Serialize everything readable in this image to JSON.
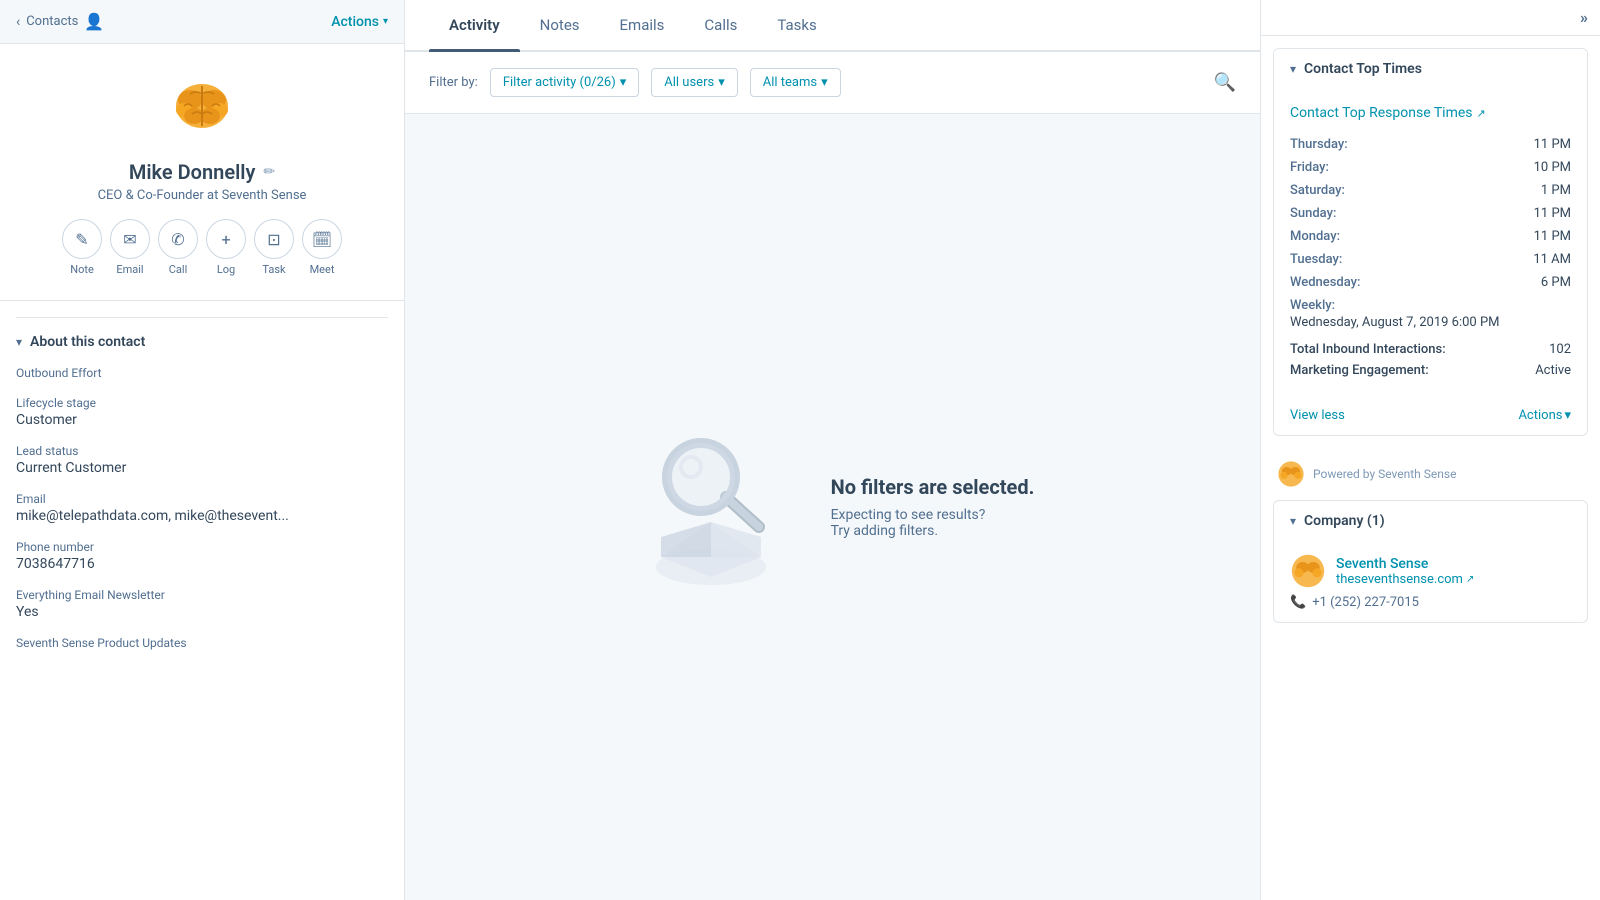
{
  "sidebar": {
    "back_label": "Contacts",
    "actions_label": "Actions",
    "contact": {
      "name": "Mike Donnelly",
      "title": "CEO & Co-Founder at Seventh Sense"
    },
    "action_buttons": [
      {
        "id": "note",
        "icon": "✎",
        "label": "Note"
      },
      {
        "id": "email",
        "icon": "✉",
        "label": "Email"
      },
      {
        "id": "call",
        "icon": "✆",
        "label": "Call"
      },
      {
        "id": "log",
        "icon": "+",
        "label": "Log"
      },
      {
        "id": "task",
        "icon": "⊡",
        "label": "Task"
      },
      {
        "id": "meet",
        "icon": "📅",
        "label": "Meet"
      }
    ],
    "about_title": "About this contact",
    "fields": [
      {
        "label": "Outbound Effort",
        "value": ""
      },
      {
        "label": "Lifecycle stage",
        "value": "Customer"
      },
      {
        "label": "Lead status",
        "value": "Current Customer"
      },
      {
        "label": "Email",
        "value": "mike@telepathdata.com, mike@thesevent..."
      },
      {
        "label": "Phone number",
        "value": "7038647716"
      },
      {
        "label": "Everything Email Newsletter",
        "value": "Yes"
      },
      {
        "label": "Seventh Sense Product Updates",
        "value": ""
      }
    ]
  },
  "tabs": [
    {
      "id": "activity",
      "label": "Activity",
      "active": true
    },
    {
      "id": "notes",
      "label": "Notes",
      "active": false
    },
    {
      "id": "emails",
      "label": "Emails",
      "active": false
    },
    {
      "id": "calls",
      "label": "Calls",
      "active": false
    },
    {
      "id": "tasks",
      "label": "Tasks",
      "active": false
    }
  ],
  "filter": {
    "label": "Filter by:",
    "activity_filter": "Filter activity (0/26)",
    "users_filter": "All users",
    "teams_filter": "All teams"
  },
  "empty_state": {
    "heading": "No filters are selected.",
    "subtext1": "Expecting to see results?",
    "subtext2": "Try adding filters."
  },
  "right_panel": {
    "contact_top_times": {
      "title": "Contact Top Times",
      "response_times_label": "Contact Top Response Times",
      "times": [
        {
          "day": "Thursday:",
          "time": "11 PM"
        },
        {
          "day": "Friday:",
          "time": "10 PM"
        },
        {
          "day": "Saturday:",
          "time": "1 PM"
        },
        {
          "day": "Sunday:",
          "time": "11 PM"
        },
        {
          "day": "Monday:",
          "time": "11 PM"
        },
        {
          "day": "Tuesday:",
          "time": "11 AM"
        },
        {
          "day": "Wednesday:",
          "time": "6 PM"
        }
      ],
      "weekly_label": "Weekly:",
      "weekly_value": "Wednesday, August 7, 2019 6:00 PM",
      "total_inbound_label": "Total Inbound Interactions:",
      "total_inbound_value": "102",
      "marketing_engagement_label": "Marketing Engagement:",
      "marketing_engagement_value": "Active",
      "view_less": "View less",
      "actions_label": "Actions"
    },
    "powered_by": "Powered by Seventh Sense",
    "company": {
      "title": "Company (1)",
      "name": "Seventh Sense",
      "domain": "theseventhsense.com",
      "phone": "+1 (252) 227-7015"
    }
  }
}
